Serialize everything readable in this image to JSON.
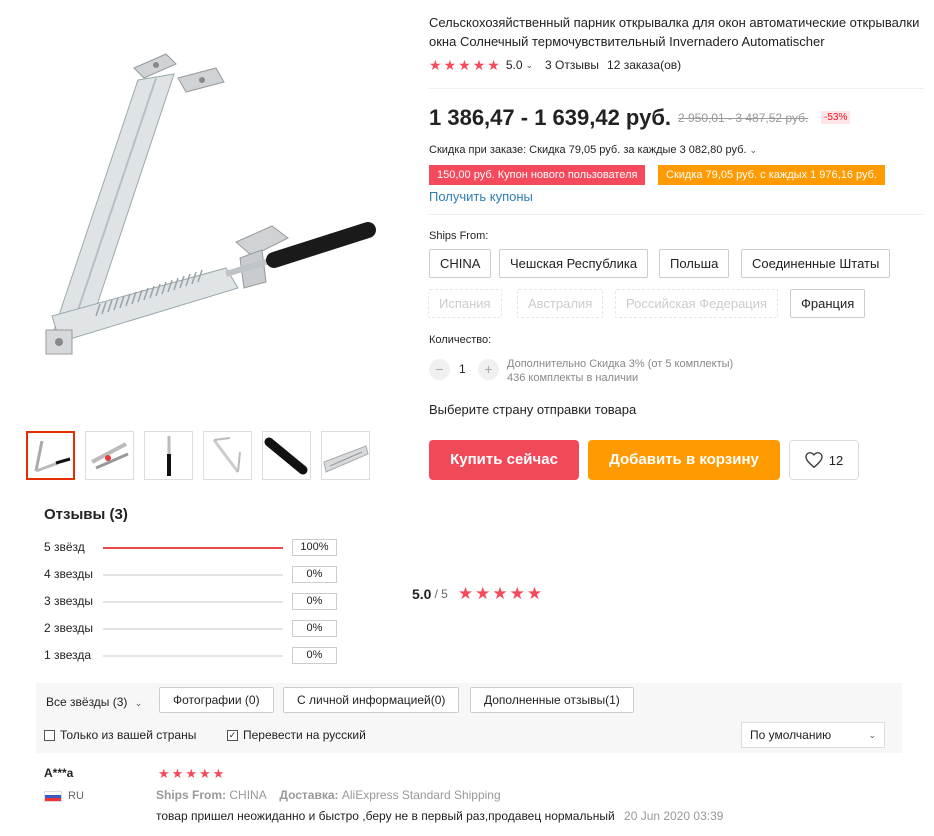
{
  "product": {
    "title": "Сельскохозяйственный парник открывалка для окон автоматические открывалки окна Солнечный термочувствительный Invernadero Automatischer",
    "rating": "5.0",
    "reviews_count": "3 Отзывы",
    "orders": "12 заказа(ов)",
    "price": "1 386,47 - 1 639,42 руб.",
    "old_price": "2 950,01 - 3 487,52 руб.",
    "discount": "-53%",
    "order_discount": "Скидка при заказе: Скидка 79,05 руб. за каждые 3 082,80 руб.",
    "coupon_new_user": "150,00 руб. Купон нового пользователя",
    "coupon_discount": "Скидка 79,05 руб. с каждых 1 976,16 руб.",
    "get_coupons": "Получить купоны",
    "ships_from_label": "Ships From:",
    "ships_from": [
      {
        "label": "CHINA",
        "enabled": true
      },
      {
        "label": "Чешская Республика",
        "enabled": true
      },
      {
        "label": "Польша",
        "enabled": true
      },
      {
        "label": "Соединенные Штаты",
        "enabled": true
      },
      {
        "label": "Испания",
        "enabled": false
      },
      {
        "label": "Австралия",
        "enabled": false
      },
      {
        "label": "Российская Федерация",
        "enabled": false
      },
      {
        "label": "Франция",
        "enabled": true
      }
    ],
    "quantity_label": "Количество:",
    "quantity": "1",
    "quantity_minus": "−",
    "quantity_plus": "+",
    "extra_discount": "Дополнительно Скидка 3% (от 5 комплекты)",
    "in_stock": "436 комплекты в наличии",
    "choose_country": "Выберите страну отправки товара",
    "buy_now": "Купить сейчас",
    "add_to_cart": "Добавить в корзину",
    "wishlist_count": "12"
  },
  "reviews": {
    "title": "Отзывы (3)",
    "breakdown": [
      {
        "label": "5 звёзд",
        "percent": "100%",
        "fraction": 1.0
      },
      {
        "label": "4 звезды",
        "percent": "0%",
        "fraction": 0
      },
      {
        "label": "3 звезды",
        "percent": "0%",
        "fraction": 0
      },
      {
        "label": "2 звезды",
        "percent": "0%",
        "fraction": 0
      },
      {
        "label": "1 звезда",
        "percent": "0%",
        "fraction": 0
      }
    ],
    "average": "5.0",
    "average_of": "/ 5",
    "filters": {
      "all_stars": "Все звёзды (3)",
      "photos": "Фотографии (0)",
      "with_info": "С личной информацией(0)",
      "additional": "Дополненные отзывы(1)",
      "only_your_country": "Только из вашей страны",
      "translate": "Перевести на русский",
      "sort": "По умолчанию"
    },
    "items": [
      {
        "name": "A***a",
        "country": "RU",
        "stars": 5,
        "ships_from_label": "Ships From:",
        "ships_from": "CHINA",
        "delivery_label": "Доставка:",
        "delivery": "AliExpress Standard Shipping",
        "text": "товар пришел неожиданно и быстро ,беру не в первый раз,продавец нормальный",
        "date": "20 Jun 2020 03:39"
      }
    ]
  },
  "colors": {
    "accent_red": "#f04a5a",
    "accent_orange": "#ff9a00",
    "star": "#f44a5b",
    "link": "#2a7fb5"
  }
}
